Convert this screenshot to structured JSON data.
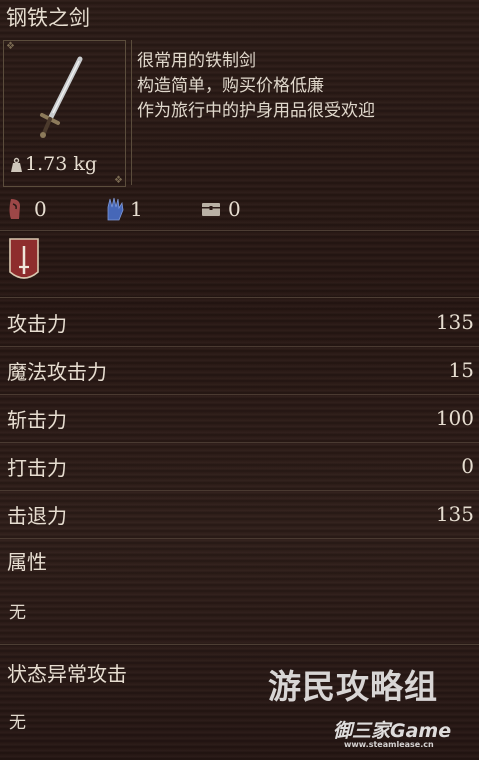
{
  "item": {
    "name": "钢铁之剑",
    "weight": "1.73 kg",
    "description": [
      "很常用的铁制剑",
      "构造简单，购买价格低廉",
      "作为旅行中的护身用品很受欢迎"
    ]
  },
  "counts": [
    {
      "icon": "strength-requirement-icon",
      "value": "0"
    },
    {
      "icon": "magic-hand-icon",
      "value": "1"
    },
    {
      "icon": "chest-icon",
      "value": "0"
    }
  ],
  "stats": [
    {
      "label": "攻击力",
      "value": "135"
    },
    {
      "label": "魔法攻击力",
      "value": "15"
    },
    {
      "label": "斩击力",
      "value": "100"
    },
    {
      "label": "打击力",
      "value": "0"
    },
    {
      "label": "击退力",
      "value": "135"
    }
  ],
  "attribute": {
    "label": "属性",
    "value": "无"
  },
  "status": {
    "label": "状态异常攻击",
    "value": "无"
  },
  "watermark": {
    "line1": "游民攻略组",
    "line2": "御三家Game",
    "line3": "www.steamlease.cn"
  }
}
